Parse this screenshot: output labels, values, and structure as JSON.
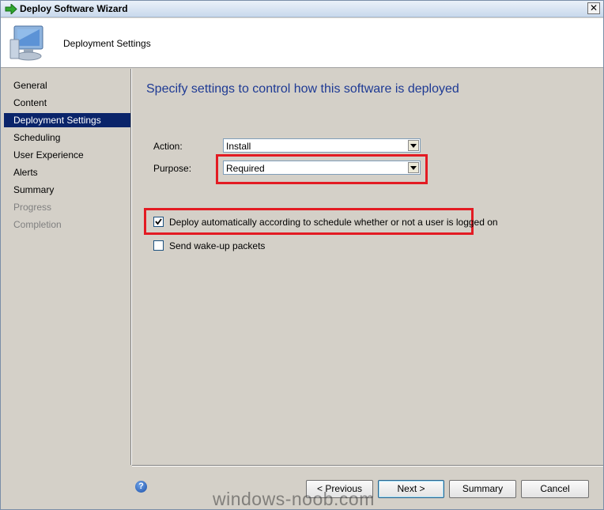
{
  "window": {
    "title": "Deploy Software Wizard",
    "close_label": "✕"
  },
  "header": {
    "title": "Deployment Settings",
    "icon": "computer-icon"
  },
  "sidebar": {
    "items": [
      {
        "label": "General",
        "state": "normal"
      },
      {
        "label": "Content",
        "state": "normal"
      },
      {
        "label": "Deployment Settings",
        "state": "selected"
      },
      {
        "label": "Scheduling",
        "state": "normal"
      },
      {
        "label": "User Experience",
        "state": "normal"
      },
      {
        "label": "Alerts",
        "state": "normal"
      },
      {
        "label": "Summary",
        "state": "normal"
      },
      {
        "label": "Progress",
        "state": "disabled"
      },
      {
        "label": "Completion",
        "state": "disabled"
      }
    ]
  },
  "main": {
    "heading": "Specify settings to control how this software is deployed",
    "action": {
      "label": "Action:",
      "value": "Install"
    },
    "purpose": {
      "label": "Purpose:",
      "value": "Required"
    },
    "deploy_auto": {
      "label": "Deploy automatically according to schedule whether or not a user is logged on",
      "checked": true
    },
    "wake_up": {
      "label": "Send wake-up packets",
      "checked": false
    }
  },
  "footer": {
    "help_label": "?",
    "previous_label": "< Previous",
    "next_label": "Next >",
    "summary_label": "Summary",
    "cancel_label": "Cancel"
  },
  "watermark": "windows-noob.com",
  "colors": {
    "highlight": "#e31b23",
    "selected_nav": "#0a246a",
    "heading": "#1e3a94"
  }
}
